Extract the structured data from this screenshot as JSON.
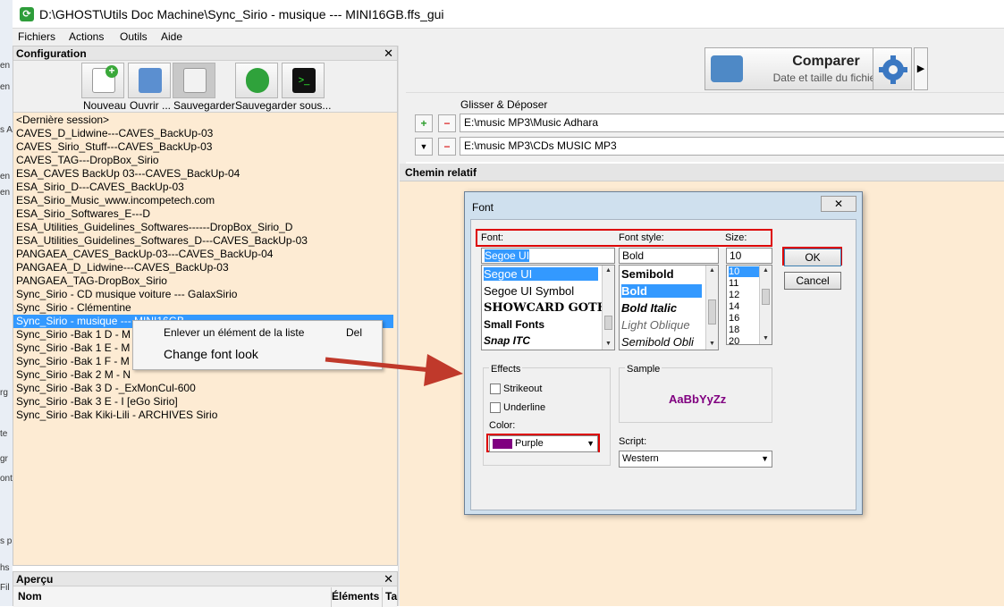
{
  "window": {
    "title": "D:\\GHOST\\Utils Doc Machine\\Sync_Sirio - musique --- MINI16GB.ffs_gui"
  },
  "menu": [
    "Fichiers",
    "Actions",
    "Outils",
    "Aide"
  ],
  "config": {
    "title": "Configuration",
    "toolbar": [
      "Nouveau",
      "Ouvrir ...",
      "Sauvegarder",
      "Sauvegarder sous..."
    ],
    "sessions": [
      "<Dernière session>",
      "CAVES_D_Lidwine---CAVES_BackUp-03",
      "CAVES_Sirio_Stuff---CAVES_BackUp-03",
      "CAVES_TAG---DropBox_Sirio",
      "ESA_CAVES BackUp 03---CAVES_BackUp-04",
      "ESA_Sirio_D---CAVES_BackUp-03",
      "ESA_Sirio_Music_www.incompetech.com",
      "ESA_Sirio_Softwares_E---D",
      "ESA_Utilities_Guidelines_Softwares------DropBox_Sirio_D",
      "ESA_Utilities_Guidelines_Softwares_D---CAVES_BackUp-03",
      "PANGAEA_CAVES_BackUp-03---CAVES_BackUp-04",
      "PANGAEA_D_Lidwine---CAVES_BackUp-03",
      "PANGAEA_TAG-DropBox_Sirio",
      "Sync_Sirio - CD musique voiture --- GalaxSirio",
      "Sync_Sirio - Clémentine",
      "Sync_Sirio - musique --- MINI16GB",
      "Sync_Sirio -Bak 1 D - M",
      "Sync_Sirio -Bak 1 E - M",
      "Sync_Sirio -Bak 1 F - M",
      "Sync_Sirio -Bak 2 M - N",
      "Sync_Sirio -Bak 3 D -_ExMonCul-600",
      "Sync_Sirio -Bak 3 E - I [eGo Sirio]",
      "Sync_Sirio -Bak Kiki-Lili - ARCHIVES Sirio"
    ],
    "selected_index": 15
  },
  "context_menu": {
    "remove": "Enlever un élément de la liste",
    "remove_shortcut": "Del",
    "change_font": "Change font look"
  },
  "apercu": {
    "title": "Aperçu",
    "col_nom": "Nom",
    "col_elements": "Éléments",
    "col_ta": "Ta"
  },
  "compare": {
    "label": "Comparer",
    "sub": "Date et taille du fichier"
  },
  "folders": {
    "dnd_label": "Glisser & Déposer",
    "left_path": "E:\\music MP3\\Music Adhara",
    "right_path": "E:\\music MP3\\CDs MUSIC MP3"
  },
  "relative_path_label": "Chemin relatif",
  "font_dialog": {
    "title": "Font",
    "close": "✕",
    "font_label": "Font:",
    "style_label": "Font style:",
    "size_label": "Size:",
    "font_value": "Segoe UI",
    "style_value": "Bold",
    "size_value": "10",
    "fonts": [
      "Segoe UI",
      "Segoe UI Symbol",
      "SHOWCARD GOTHI",
      "Small Fonts",
      "Snap ITC"
    ],
    "styles": [
      "Semibold",
      "Bold",
      "Bold Italic",
      "Light Oblique",
      "Semibold Obli"
    ],
    "sizes": [
      "10",
      "11",
      "12",
      "14",
      "16",
      "18",
      "20"
    ],
    "ok": "OK",
    "cancel": "Cancel",
    "effects_label": "Effects",
    "strikeout": "Strikeout",
    "underline": "Underline",
    "color_label": "Color:",
    "color_value": "Purple",
    "color_hex": "#800080",
    "sample_label": "Sample",
    "sample_text": "AaBbYyZz",
    "script_label": "Script:",
    "script_value": "Western"
  },
  "desktop_strip": [
    "en",
    "en",
    "s A",
    "en",
    "en",
    "rg",
    "te",
    "gr",
    "ont",
    "s p",
    "hs",
    "Fil"
  ],
  "colors": {
    "selection": "#3399ff",
    "list_bg": "#fdebd3",
    "highlight_red": "#dd0000",
    "arrow": "#c0392b"
  }
}
